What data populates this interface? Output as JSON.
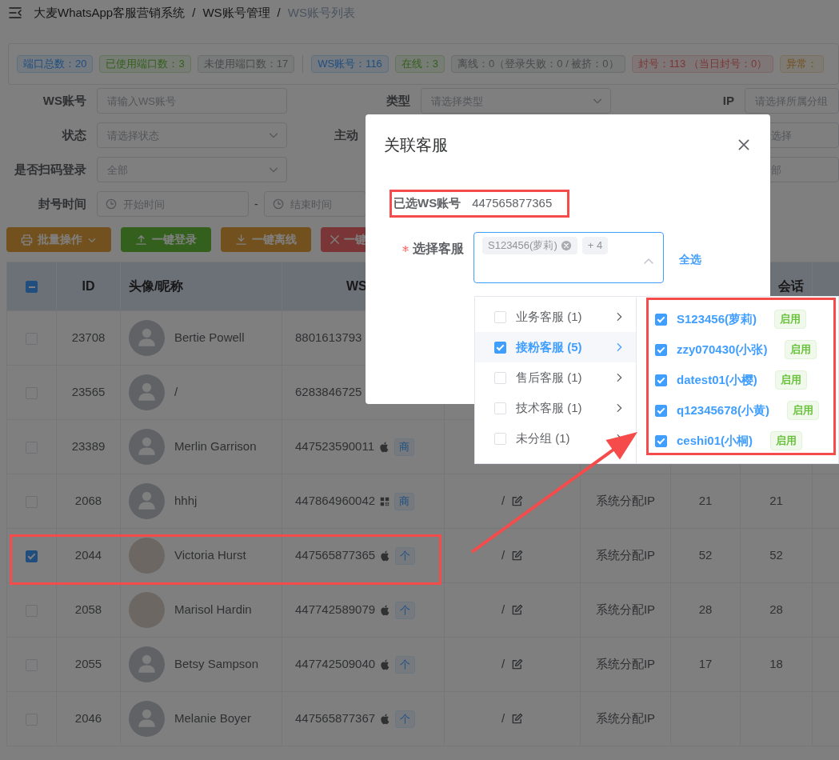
{
  "breadcrumb": [
    {
      "label": "大麦WhatsApp客服营销系统",
      "current": false,
      "separator": "/"
    },
    {
      "label": "WS账号管理",
      "current": false,
      "separator": "/"
    },
    {
      "label": "WS账号列表",
      "current": true
    }
  ],
  "stat_groups": [
    {
      "tags": [
        {
          "label": "端口总数：20",
          "color": "#204f80"
        },
        {
          "label": "已使用端口数：3",
          "color": "#34611d"
        },
        {
          "label": "未使用端口数：17",
          "color": "#484a4c"
        }
      ]
    },
    {
      "tags": [
        {
          "label": "WS账号：116",
          "color": "#204f80"
        },
        {
          "label": "在线：3",
          "color": "#34611d"
        },
        {
          "label": "离线：0（登录失败：0 / 被挤：0）",
          "color": "#484a4c"
        },
        {
          "label": "封号：113 （当日封号：0）",
          "color": "#7b3636"
        },
        {
          "label": "异常：",
          "color": "#73511e"
        }
      ]
    }
  ],
  "filters": {
    "ws_account": {
      "label": "WS账号",
      "placeholder": "请输入WS账号"
    },
    "type": {
      "label": "类型",
      "placeholder": "请选择类型"
    },
    "ip": {
      "label": "IP",
      "placeholder": "请选择所属分组"
    },
    "status": {
      "label": "状态",
      "placeholder": "请选择状态"
    },
    "active_create": {
      "label": "主动"
    },
    "column_3_row_2": {
      "placeholder": "选择"
    },
    "scan_login": {
      "label": "是否扫码登录",
      "placeholder": "全部"
    },
    "column_3_row_3": {
      "placeholder": "部"
    },
    "ban_time": {
      "label": "封号时间",
      "start_placeholder": "开始时间",
      "separator": "-",
      "end_placeholder": "结束时间"
    }
  },
  "buttons": [
    {
      "label": "批量操作",
      "kind": "warning",
      "dropdown": true
    },
    {
      "label": "一键登录",
      "kind": "success",
      "dropdown": false
    },
    {
      "label": "一键离线",
      "kind": "warning",
      "dropdown": false
    },
    {
      "label": "一键",
      "kind": "danger",
      "dropdown": false
    }
  ],
  "table": {
    "select_all": {
      "indeterminate": true
    },
    "column_headers": {
      "id": "ID",
      "name": "头像/昵称",
      "ws": "WS",
      "column_8": "会话"
    },
    "rows": [
      {
        "id": "23708",
        "name": "Bertie Powell",
        "has_photo": false,
        "ws": "8801613793",
        "selected": false
      },
      {
        "id": "23565",
        "name": "/",
        "has_photo": false,
        "ws": "6283846725",
        "selected": false
      },
      {
        "id": "23389",
        "name": "Merlin Garrison",
        "has_photo": false,
        "ws": "447523590011",
        "ios": true,
        "tag": "商",
        "selected": false
      },
      {
        "id": "2068",
        "name": "hhhj",
        "has_photo": false,
        "ws": "447864960042",
        "ios": false,
        "tag": "商",
        "remark": "/",
        "ip": "系统分配IP",
        "column_7": "21",
        "column_8": "21",
        "selected": false
      },
      {
        "id": "2044",
        "name": "Victoria Hurst",
        "has_photo": true,
        "ws": "447565877365",
        "ios": true,
        "tag": "个",
        "remark": "/",
        "ip": "系统分配IP",
        "column_7": "52",
        "column_8": "52",
        "selected": true
      },
      {
        "id": "2058",
        "name": "Marisol Hardin",
        "has_photo": true,
        "ws": "447742589079",
        "ios": true,
        "tag": "个",
        "remark": "/",
        "ip": "系统分配IP",
        "column_7": "28",
        "column_8": "28",
        "selected": false
      },
      {
        "id": "2055",
        "name": "Betsy Sampson",
        "has_photo": false,
        "ws": "447742509040",
        "ios": true,
        "tag": "个",
        "remark": "/",
        "ip": "系统分配IP",
        "column_7": "17",
        "column_8": "18",
        "selected": false
      },
      {
        "id": "2046",
        "name": "Melanie Boyer",
        "has_photo": false,
        "ws": "447565877367",
        "ios": true,
        "tag": "个",
        "remark": "/",
        "ip": "系统分配IP",
        "selected": false
      }
    ]
  },
  "dialog": {
    "title": "关联客服",
    "selected_label": "已选WS账号",
    "selected_value": "447565877365",
    "field_label": "选择客服",
    "required": true,
    "tags": [
      {
        "label": "S123456(萝莉)",
        "closable": true
      },
      {
        "label": "+ 4",
        "closable": false
      }
    ],
    "select_all": "全选",
    "groups": [
      {
        "label": "业务客服 (1)",
        "checked": false,
        "selected": false
      },
      {
        "label": "接粉客服 (5)",
        "checked": true,
        "selected": true
      },
      {
        "label": "售后客服 (1)",
        "checked": false,
        "selected": false
      },
      {
        "label": "技术客服 (1)",
        "checked": false,
        "selected": false
      },
      {
        "label": "未分组 (1)",
        "checked": false,
        "selected": false
      }
    ],
    "options": [
      {
        "label": "S123456(萝莉)",
        "checked": true,
        "status": "启用"
      },
      {
        "label": "zzy070430(小张)",
        "checked": true,
        "status": "启用"
      },
      {
        "label": "datest01(小樱)",
        "checked": true,
        "status": "启用"
      },
      {
        "label": "q12345678(小黄)",
        "checked": true,
        "status": "启用"
      },
      {
        "label": "ceshi01(小桐)",
        "checked": true,
        "status": "启用"
      }
    ]
  }
}
